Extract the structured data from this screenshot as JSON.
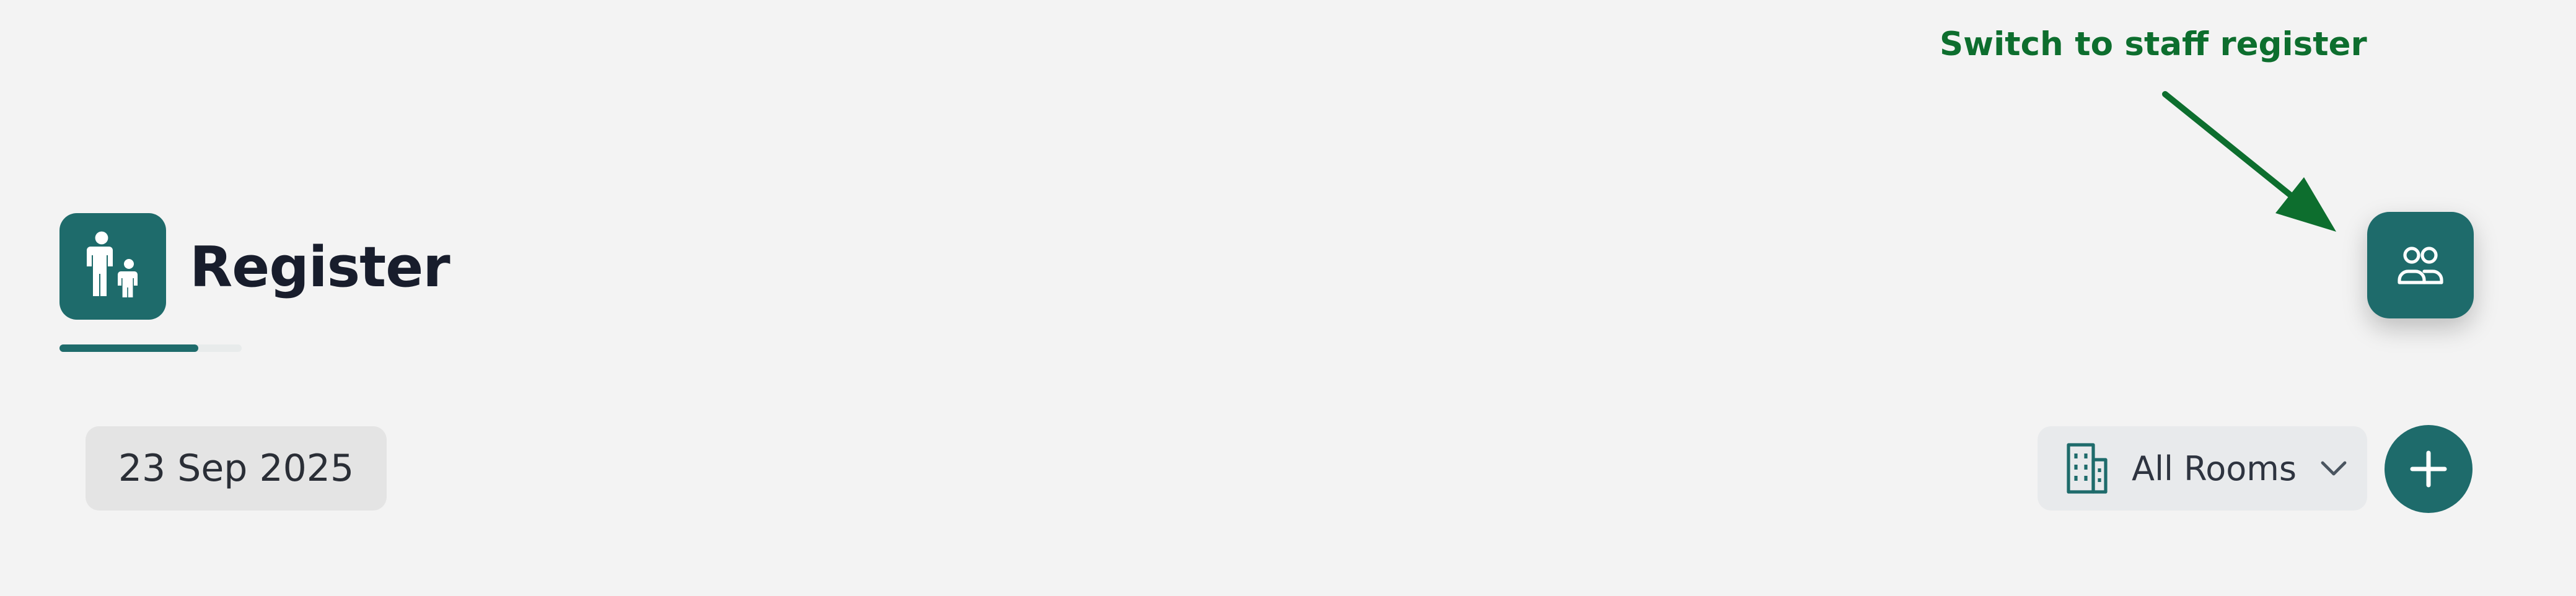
{
  "header": {
    "title": "Register",
    "icon": "adult-child-icon"
  },
  "annotation": {
    "text": "Switch to staff register",
    "color": "#0d6e2e"
  },
  "staff_button": {
    "icon": "staff-group-icon"
  },
  "date_picker": {
    "value": "23 Sep 2025"
  },
  "rooms_dropdown": {
    "selected": "All Rooms",
    "icon": "building-icon"
  },
  "add_button": {
    "icon": "plus-icon"
  },
  "colors": {
    "accent": "#1e6b6b",
    "background": "#f3f3f3",
    "title": "#181d2c"
  }
}
